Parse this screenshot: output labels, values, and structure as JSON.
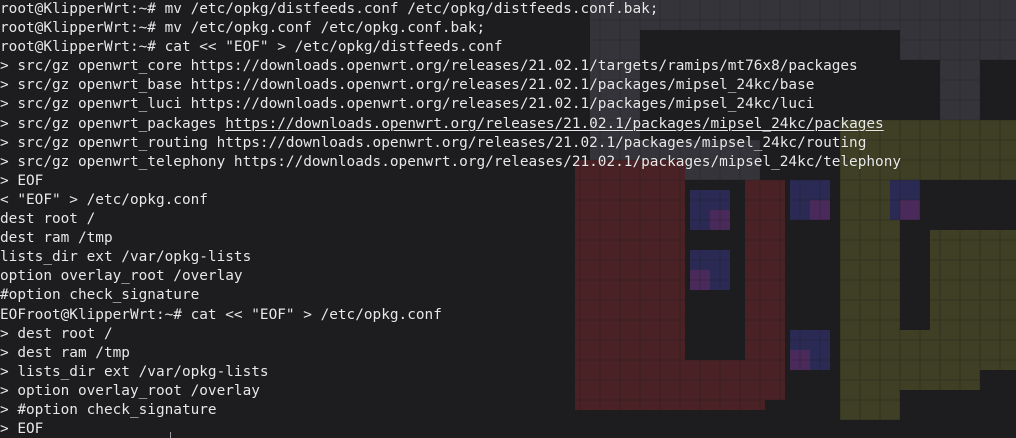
{
  "terminal": {
    "background_color": "#1d1d20",
    "text_color": "#e8e8e8",
    "lines": [
      {
        "text": "root@KlipperWrt:~# mv /etc/opkg/distfeeds.conf /etc/opkg/distfeeds.conf.bak;"
      },
      {
        "text": "root@KlipperWrt:~# mv /etc/opkg.conf /etc/opkg.conf.bak;"
      },
      {
        "text": "root@KlipperWrt:~# cat << \"EOF\" > /etc/opkg/distfeeds.conf"
      },
      {
        "text": "> src/gz openwrt_core https://downloads.openwrt.org/releases/21.02.1/targets/ramips/mt76x8/packages"
      },
      {
        "text": "> src/gz openwrt_base https://downloads.openwrt.org/releases/21.02.1/packages/mipsel_24kc/base"
      },
      {
        "text": "> src/gz openwrt_luci https://downloads.openwrt.org/releases/21.02.1/packages/mipsel_24kc/luci"
      },
      {
        "prefix": "> src/gz openwrt_packages ",
        "link": "https://downloads.openwrt.org/releases/21.02.1/packages/mipsel_24kc/packages"
      },
      {
        "text": "> src/gz openwrt_routing https://downloads.openwrt.org/releases/21.02.1/packages/mipsel_24kc/routing"
      },
      {
        "text": "> src/gz openwrt_telephony https://downloads.openwrt.org/releases/21.02.1/packages/mipsel_24kc/telephony"
      },
      {
        "text": "> EOF"
      },
      {
        "text": "< \"EOF\" > /etc/opkg.conf"
      },
      {
        "text": "dest root /"
      },
      {
        "text": "dest ram /tmp"
      },
      {
        "text": "lists_dir ext /var/opkg-lists"
      },
      {
        "text": "option overlay_root /overlay"
      },
      {
        "text": "#option check_signature"
      },
      {
        "text": "EOFroot@KlipperWrt:~# cat << \"EOF\" > /etc/opkg.conf"
      },
      {
        "text": "> dest root /"
      },
      {
        "text": "> dest ram /tmp"
      },
      {
        "text": "> lists_dir ext /var/opkg-lists"
      },
      {
        "text": "> option overlay_root /overlay"
      },
      {
        "text": "> #option check_signature"
      },
      {
        "text": "> EOF"
      }
    ]
  },
  "background_art": {
    "icon": "pixel-art-logo-icon",
    "colors": {
      "gray": "#34343a",
      "red": "#4a2226",
      "olive": "#3e3f24",
      "blue": "#2b2a55",
      "purple": "#4a2a5a"
    }
  }
}
